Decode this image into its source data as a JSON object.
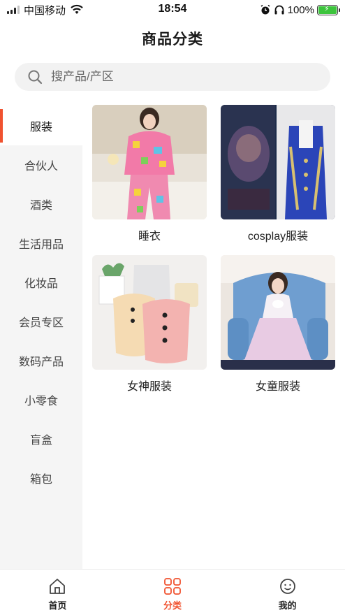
{
  "status_bar": {
    "carrier": "中国移动",
    "time": "18:54",
    "battery": "100%"
  },
  "nav": {
    "title": "商品分类"
  },
  "search": {
    "placeholder": "搜产品/产区"
  },
  "sidebar": {
    "items": [
      {
        "label": "服装",
        "active": true
      },
      {
        "label": "合伙人"
      },
      {
        "label": "酒类"
      },
      {
        "label": "生活用品"
      },
      {
        "label": "化妆品"
      },
      {
        "label": "会员专区"
      },
      {
        "label": "数码产品"
      },
      {
        "label": "小零食"
      },
      {
        "label": "盲盒"
      },
      {
        "label": "箱包"
      }
    ]
  },
  "products": [
    {
      "label": "睡衣",
      "image": "pajamas-photo"
    },
    {
      "label": "cosplay服装",
      "image": "cosplay-costume-photo"
    },
    {
      "label": "女神服装",
      "image": "women-underwear-photo"
    },
    {
      "label": "女童服装",
      "image": "girl-dress-photo"
    }
  ],
  "tabbar": {
    "tabs": [
      {
        "label": "首页",
        "icon": "home-icon"
      },
      {
        "label": "分类",
        "icon": "category-icon",
        "active": true
      },
      {
        "label": "我的",
        "icon": "profile-icon"
      }
    ]
  },
  "colors": {
    "accent": "#f0522f",
    "sidebar_bg": "#f5f5f5",
    "search_bg": "#f2f2f2"
  }
}
